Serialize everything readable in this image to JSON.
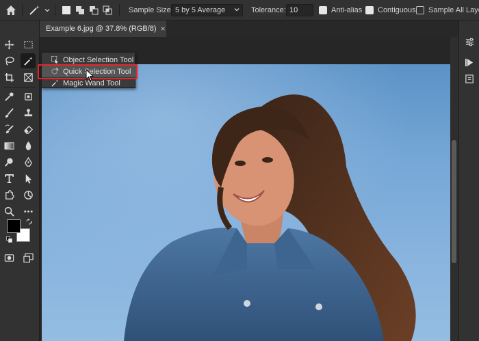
{
  "options_bar": {
    "sample_size_label": "Sample Size:",
    "sample_size_value": "5 by 5 Average",
    "tolerance_label": "Tolerance:",
    "tolerance_value": "10",
    "anti_alias_label": "Anti-alias",
    "anti_alias_checked": true,
    "contiguous_label": "Contiguous",
    "contiguous_checked": true,
    "sample_all_layers_label": "Sample All Layers",
    "sample_all_layers_checked": false
  },
  "document": {
    "tab_title": "Example 6.jpg @ 37.8% (RGB/8)",
    "close_glyph": "×"
  },
  "flyout": {
    "items": [
      {
        "label": "Object Selection Tool",
        "icon": "object-selection-icon"
      },
      {
        "label": "Quick Selection Tool",
        "icon": "quick-selection-icon",
        "highlighted": true
      },
      {
        "label": "Magic Wand Tool",
        "icon": "magic-wand-icon"
      }
    ]
  },
  "colors": {
    "accent_highlight": "#e4262b",
    "foreground_swatch": "#000000",
    "background_swatch": "#ffffff"
  }
}
